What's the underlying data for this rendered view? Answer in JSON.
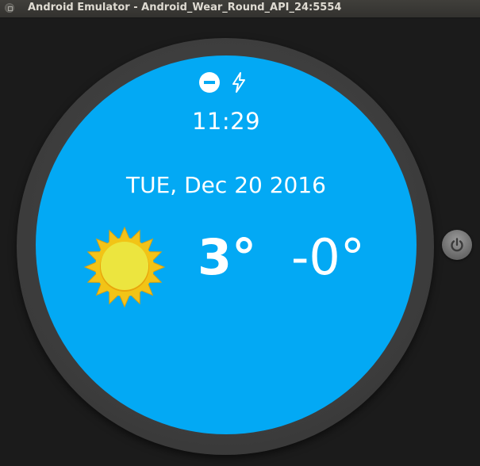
{
  "window": {
    "title": "Android Emulator - Android_Wear_Round_API_24:5554"
  },
  "watch": {
    "status_icons": [
      "do-not-disturb-icon",
      "charging-bolt-icon"
    ],
    "time": "11:29",
    "date": "TUE, Dec 20 2016",
    "weather": {
      "icon": "sun-icon",
      "high": "3°",
      "low": "-0°"
    },
    "face_color": "#03a9f4"
  },
  "controls": {
    "power_icon": "power-icon"
  }
}
